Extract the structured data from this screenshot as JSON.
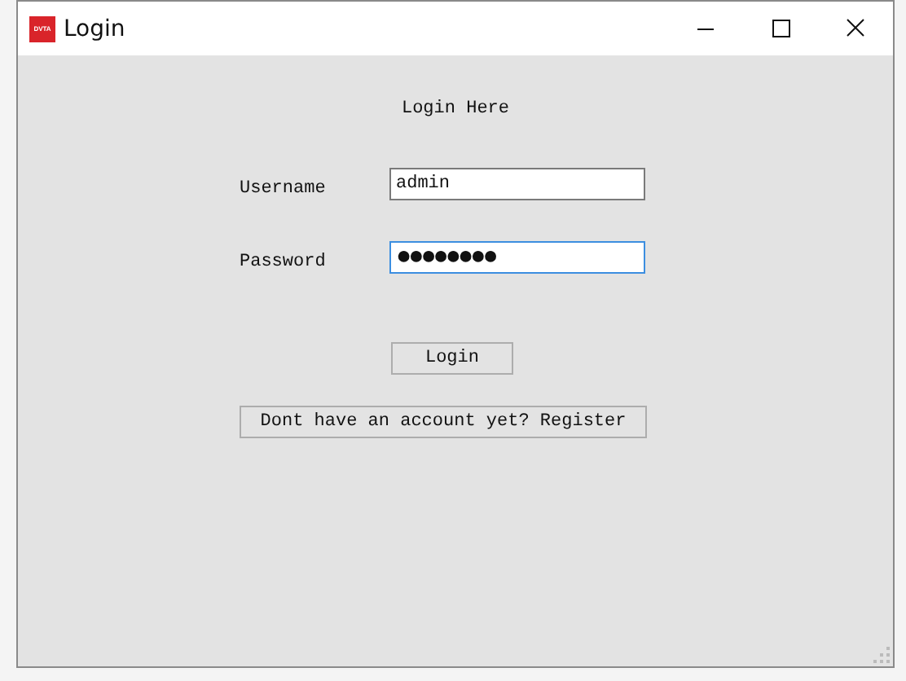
{
  "window": {
    "app_icon": "DVTA",
    "title": "Login"
  },
  "heading": "Login Here",
  "fields": [
    {
      "label": "Username",
      "value": "admin",
      "focused": false
    },
    {
      "label": "Password",
      "value": "●●●●●●●●",
      "focused": true
    }
  ],
  "buttons": [
    {
      "label": "Login",
      "kind": "short"
    },
    {
      "label": "Dont have an account yet? Register",
      "kind": "wide"
    }
  ]
}
